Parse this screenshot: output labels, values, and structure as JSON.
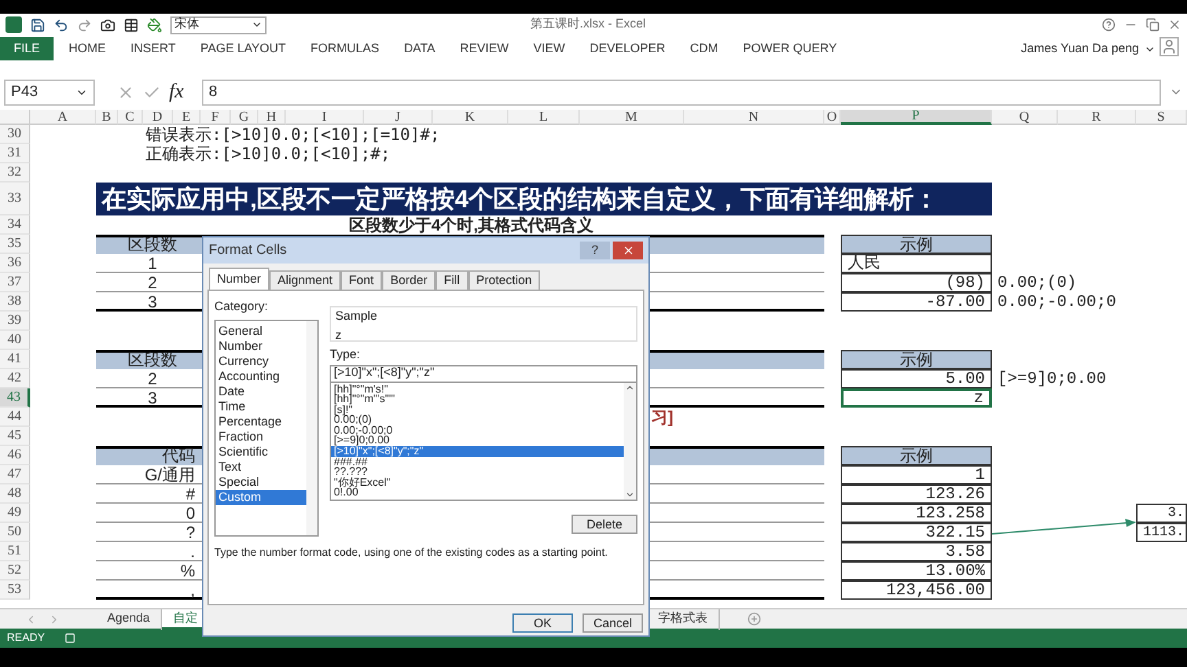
{
  "title_bar": {
    "font_box": "宋体",
    "title": "第五课时.xlsx - Excel"
  },
  "ribbon_tabs": [
    {
      "label": "FILE",
      "kind": "file"
    },
    {
      "label": "HOME",
      "kind": "tab"
    },
    {
      "label": "INSERT",
      "kind": "tab"
    },
    {
      "label": "PAGE LAYOUT",
      "kind": "tab"
    },
    {
      "label": "FORMULAS",
      "kind": "tab"
    },
    {
      "label": "DATA",
      "kind": "tab"
    },
    {
      "label": "REVIEW",
      "kind": "tab"
    },
    {
      "label": "VIEW",
      "kind": "tab"
    },
    {
      "label": "DEVELOPER",
      "kind": "tab"
    },
    {
      "label": "CDM",
      "kind": "tab"
    },
    {
      "label": "POWER QUERY",
      "kind": "tab"
    }
  ],
  "user": "James Yuan Da peng",
  "formula_bar": {
    "name_box": "P43",
    "fx": "fx",
    "formula": "8"
  },
  "columns": [
    {
      "label": "A",
      "selected": false
    },
    {
      "label": "B",
      "selected": false
    },
    {
      "label": "C",
      "selected": false
    },
    {
      "label": "D",
      "selected": false
    },
    {
      "label": "E",
      "selected": false
    },
    {
      "label": "F",
      "selected": false
    },
    {
      "label": "G",
      "selected": false
    },
    {
      "label": "H",
      "selected": false
    },
    {
      "label": "I",
      "selected": false
    },
    {
      "label": "J",
      "selected": false
    },
    {
      "label": "K",
      "selected": false
    },
    {
      "label": "L",
      "selected": false
    },
    {
      "label": "M",
      "selected": false
    },
    {
      "label": "N",
      "selected": false
    },
    {
      "label": "O",
      "selected": false
    },
    {
      "label": "P",
      "selected": true
    },
    {
      "label": "Q",
      "selected": false
    },
    {
      "label": "R",
      "selected": false
    },
    {
      "label": "S",
      "selected": false
    }
  ],
  "rows": [
    {
      "label": "30",
      "selected": false
    },
    {
      "label": "31",
      "selected": false
    },
    {
      "label": "32",
      "selected": false
    },
    {
      "label": "33",
      "selected": false
    },
    {
      "label": "34",
      "selected": false
    },
    {
      "label": "35",
      "selected": false
    },
    {
      "label": "36",
      "selected": false
    },
    {
      "label": "37",
      "selected": false
    },
    {
      "label": "38",
      "selected": false
    },
    {
      "label": "39",
      "selected": false
    },
    {
      "label": "40",
      "selected": false
    },
    {
      "label": "41",
      "selected": false
    },
    {
      "label": "42",
      "selected": false
    },
    {
      "label": "43",
      "selected": true
    },
    {
      "label": "44",
      "selected": false
    },
    {
      "label": "45",
      "selected": false
    },
    {
      "label": "46",
      "selected": false
    },
    {
      "label": "47",
      "selected": false
    },
    {
      "label": "48",
      "selected": false
    },
    {
      "label": "49",
      "selected": false
    },
    {
      "label": "50",
      "selected": false
    },
    {
      "label": "51",
      "selected": false
    },
    {
      "label": "52",
      "selected": false
    },
    {
      "label": "53",
      "selected": false
    }
  ],
  "notes": [
    "错误表示:[>10]0.0;[<10];[=10]#;",
    "正确表示:[>10]0.0;[<10];#;"
  ],
  "banner": "在实际应用中,区段不一定严格按4个区段的结构来自定义，下面有详细解析：",
  "subtitle": "区段数少于4个时,其格式代码含义",
  "table_1": {
    "header": "区段数",
    "example_header": "示例",
    "rows": [
      {
        "label": "1",
        "example": "人民",
        "kind": "text",
        "format": "",
        "selected": false
      },
      {
        "label": "2",
        "example": "(98)",
        "kind": "number",
        "format": "0.00;(0)",
        "selected": false
      },
      {
        "label": "3",
        "example": "-87.00",
        "kind": "number",
        "format": "0.00;-0.00;0",
        "selected": false
      }
    ]
  },
  "table_2": {
    "header": "区段数",
    "example_header": "示例",
    "rows": [
      {
        "label": "2",
        "example": "5.00",
        "kind": "number",
        "format": "[>=9]0;0.00",
        "selected": false
      },
      {
        "label": "3",
        "example": "z",
        "kind": "number",
        "format": "",
        "selected": true
      }
    ]
  },
  "section_note": "习]",
  "table_3": {
    "header": "代码",
    "example_header": "示例",
    "rows": [
      {
        "label": "G/通用",
        "example": "1",
        "kind": "number",
        "format": "",
        "selected": false
      },
      {
        "label": "#",
        "example": "123.26",
        "kind": "number",
        "format": "",
        "selected": false
      },
      {
        "label": "0",
        "example": "123.258",
        "kind": "number",
        "format": "",
        "selected": false
      },
      {
        "label": "?",
        "example": "322.15",
        "kind": "number",
        "format": "",
        "selected": false
      },
      {
        "label": ".",
        "example": "3.58",
        "kind": "number",
        "format": "",
        "selected": false
      },
      {
        "label": "%",
        "example": "13.00%",
        "kind": "number",
        "format": "",
        "selected": false
      },
      {
        "label": ",",
        "example": "123,456.00",
        "kind": "number",
        "format": "",
        "selected": false
      }
    ]
  },
  "side_box": [
    "3.",
    "1113."
  ],
  "dialog": {
    "title": "Format Cells",
    "help": "?",
    "tabs": [
      {
        "label": "Number",
        "selected": true
      },
      {
        "label": "Alignment",
        "selected": false
      },
      {
        "label": "Font",
        "selected": false
      },
      {
        "label": "Border",
        "selected": false
      },
      {
        "label": "Fill",
        "selected": false
      },
      {
        "label": "Protection",
        "selected": false
      }
    ],
    "category_label": "Category:",
    "categories": [
      {
        "label": "General",
        "selected": false
      },
      {
        "label": "Number",
        "selected": false
      },
      {
        "label": "Currency",
        "selected": false
      },
      {
        "label": "Accounting",
        "selected": false
      },
      {
        "label": "Date",
        "selected": false
      },
      {
        "label": "Time",
        "selected": false
      },
      {
        "label": "Percentage",
        "selected": false
      },
      {
        "label": "Fraction",
        "selected": false
      },
      {
        "label": "Scientific",
        "selected": false
      },
      {
        "label": "Text",
        "selected": false
      },
      {
        "label": "Special",
        "selected": false
      },
      {
        "label": "Custom",
        "selected": true
      }
    ],
    "sample_label": "Sample",
    "sample": "z",
    "type_label": "Type:",
    "type_value": "[>10]\"x\";[<8]\"y\";\"z\"",
    "type_list": [
      {
        "label": "[hh]\"°\"m's!\"",
        "selected": false
      },
      {
        "label": "[hh]\"°\"m\"'s\"'\"",
        "selected": false
      },
      {
        "label": "[s]!\"",
        "selected": false
      },
      {
        "label": "0.00;(0)",
        "selected": false
      },
      {
        "label": "0.00;-0.00;0",
        "selected": false
      },
      {
        "label": "[>=9]0;0.00",
        "selected": false
      },
      {
        "label": "[>10]\"x\";[<8]\"y\";\"z\"",
        "selected": true
      },
      {
        "label": "###.##",
        "selected": false
      },
      {
        "label": "??.???",
        "selected": false
      },
      {
        "label": "\"你好Excel\"",
        "selected": false
      },
      {
        "label": "0!.00",
        "selected": false
      }
    ],
    "delete": "Delete",
    "description": "Type the number format code, using one of the existing codes as a starting point.",
    "buttons": [
      "OK",
      "Cancel"
    ]
  },
  "sheet_tabs": [
    {
      "label": "Agenda",
      "selected": false
    },
    {
      "label": "自定",
      "selected": true
    },
    {
      "label": "字格式表",
      "selected": false
    }
  ],
  "status_bar": {
    "status": "READY"
  }
}
